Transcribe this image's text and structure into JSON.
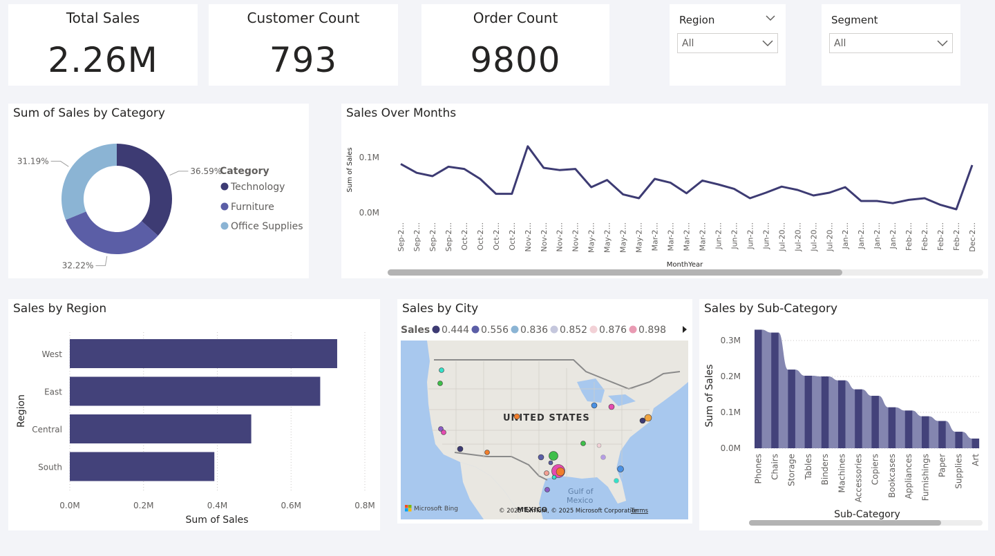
{
  "kpis": {
    "total_sales": {
      "title": "Total Sales",
      "value": "2.26M"
    },
    "customer_count": {
      "title": "Customer Count",
      "value": "793"
    },
    "order_count": {
      "title": "Order Count",
      "value": "9800"
    }
  },
  "slicers": {
    "region": {
      "title": "Region",
      "value": "All"
    },
    "segment": {
      "title": "Segment",
      "value": "All"
    }
  },
  "colors": {
    "technology": "#3d3b73",
    "furniture": "#5b5ea6",
    "office_supplies": "#8bb4d4",
    "bar": "#43427a",
    "line": "#3d3b73"
  },
  "category_chart": {
    "title": "Sum of Sales by Category",
    "legend_title": "Category",
    "chart_data": {
      "type": "pie",
      "title": "Sum of Sales by Category",
      "legend_title": "Category",
      "slices": [
        {
          "name": "Technology",
          "value": 36.59,
          "label": "36.59%",
          "color": "#3d3b73"
        },
        {
          "name": "Furniture",
          "value": 32.22,
          "label": "32.22%",
          "color": "#5b5ea6"
        },
        {
          "name": "Office Supplies",
          "value": 31.19,
          "label": "31.19%",
          "color": "#8bb4d4"
        }
      ]
    }
  },
  "months_chart": {
    "title": "Sales Over Months",
    "chart_data": {
      "type": "line",
      "title": "Sales Over Months",
      "xlabel": "MonthYear",
      "ylabel": "Sum of Sales",
      "y_ticks": [
        "0.0M",
        "0.1M"
      ],
      "ylim": [
        0,
        0.13
      ],
      "x": [
        "Sep-2...",
        "Sep-2...",
        "Sep-2...",
        "Sep-2...",
        "Oct-2...",
        "Oct-2...",
        "Oct-2...",
        "Oct-2...",
        "Nov-2...",
        "Nov-2...",
        "Nov-2...",
        "Nov-2...",
        "May-2...",
        "May-2...",
        "May-2...",
        "May-2...",
        "Mar-2...",
        "Mar-2...",
        "Mar-2...",
        "Mar-2...",
        "Jun-2...",
        "Jun-2...",
        "Jun-2...",
        "Jun-2...",
        "Jul-20...",
        "Jul-20...",
        "Jul-20...",
        "Jul-20...",
        "Jan-2...",
        "Jan-2...",
        "Jan-2...",
        "Jan-2...",
        "Feb-2...",
        "Feb-2...",
        "Feb-2...",
        "Feb-2...",
        "Dec-2..."
      ],
      "series": [
        {
          "values": [
            0.087,
            0.071,
            0.065,
            0.082,
            0.078,
            0.06,
            0.033,
            0.033,
            0.119,
            0.08,
            0.076,
            0.078,
            0.045,
            0.058,
            0.032,
            0.025,
            0.06,
            0.053,
            0.034,
            0.057,
            0.05,
            0.042,
            0.025,
            0.035,
            0.046,
            0.04,
            0.03,
            0.035,
            0.045,
            0.02,
            0.02,
            0.016,
            0.022,
            0.025,
            0.013,
            0.005,
            0.085
          ]
        }
      ],
      "scrollbar_position": 0.7
    }
  },
  "region_chart": {
    "title": "Sales by Region",
    "chart_data": {
      "type": "bar",
      "orientation": "horizontal",
      "title": "Sales by Region",
      "xlabel": "Sum of Sales",
      "ylabel": "Region",
      "categories": [
        "West",
        "East",
        "Central",
        "South"
      ],
      "values": [
        0.725,
        0.679,
        0.492,
        0.392
      ],
      "x_ticks": [
        "0.0M",
        "0.2M",
        "0.4M",
        "0.6M",
        "0.8M"
      ],
      "xlim": [
        0,
        0.8
      ]
    }
  },
  "city_map": {
    "title": "Sales by City",
    "legend_title": "Sales",
    "legend_items": [
      {
        "label": "0.444",
        "color": "#3d3b73"
      },
      {
        "label": "0.556",
        "color": "#5b5ea6"
      },
      {
        "label": "0.836",
        "color": "#8bb4d4"
      },
      {
        "label": "0.852",
        "color": "#c5c7dd"
      },
      {
        "label": "0.876",
        "color": "#f2d1d6"
      },
      {
        "label": "0.898",
        "color": "#e99bb3"
      }
    ],
    "country_label": "UNITED STATES",
    "gulf_label_1": "Gulf of",
    "gulf_label_2": "Mexico",
    "mexico_label": "MEXICO",
    "bing_label": "Microsoft Bing",
    "copyright": "© 2025 TomTom, © 2025 Microsoft Corporation",
    "terms": "Terms"
  },
  "subcat_chart": {
    "title": "Sales by Sub-Category",
    "chart_data": {
      "type": "bar",
      "title": "Sales by Sub-Category",
      "xlabel": "Sub-Category",
      "ylabel": "Sum of Sales",
      "categories": [
        "Phones",
        "Chairs",
        "Storage",
        "Tables",
        "Binders",
        "Machines",
        "Accessories",
        "Copiers",
        "Bookcases",
        "Appliances",
        "Furnishings",
        "Paper",
        "Supplies",
        "Art"
      ],
      "values": [
        0.33,
        0.322,
        0.219,
        0.202,
        0.2,
        0.189,
        0.164,
        0.146,
        0.114,
        0.105,
        0.089,
        0.076,
        0.046,
        0.027
      ],
      "y_ticks": [
        "0.0M",
        "0.1M",
        "0.2M",
        "0.3M"
      ],
      "ylim": [
        0,
        0.35
      ]
    }
  }
}
